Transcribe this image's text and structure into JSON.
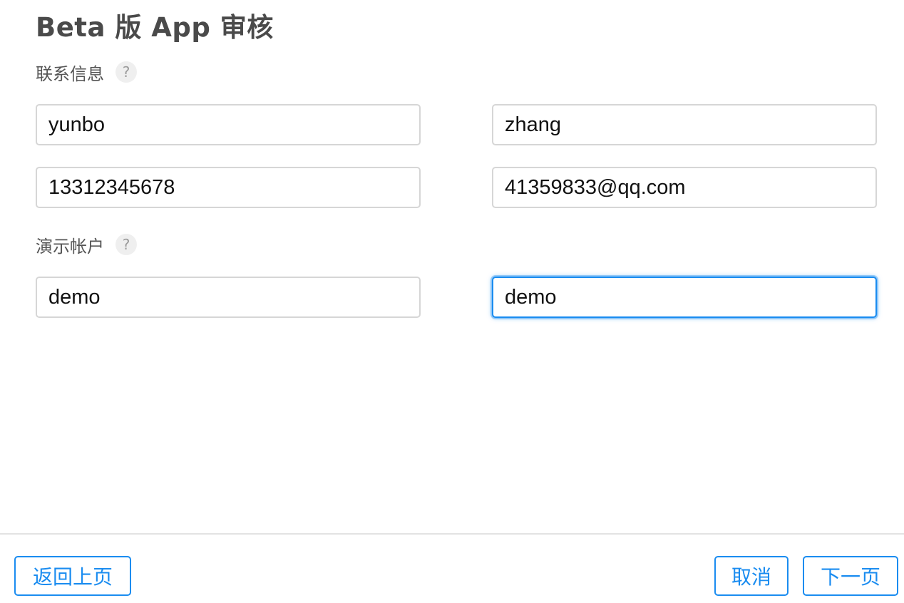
{
  "header": {
    "title": "Beta 版 App 审核"
  },
  "contact_section": {
    "label": "联系信息",
    "help_glyph": "?",
    "first_name_value": "yunbo",
    "last_name_value": "zhang",
    "phone_value": "13312345678",
    "email_value": "41359833@qq.com"
  },
  "demo_section": {
    "label": "演示帐户",
    "help_glyph": "?",
    "username_value": "demo",
    "password_value": "demo"
  },
  "footer": {
    "back_label": "返回上页",
    "cancel_label": "取消",
    "next_label": "下一页"
  },
  "colors": {
    "accent": "#1a8cf0",
    "title_text": "#4a4a4a",
    "field_border": "#d6d6d6"
  }
}
